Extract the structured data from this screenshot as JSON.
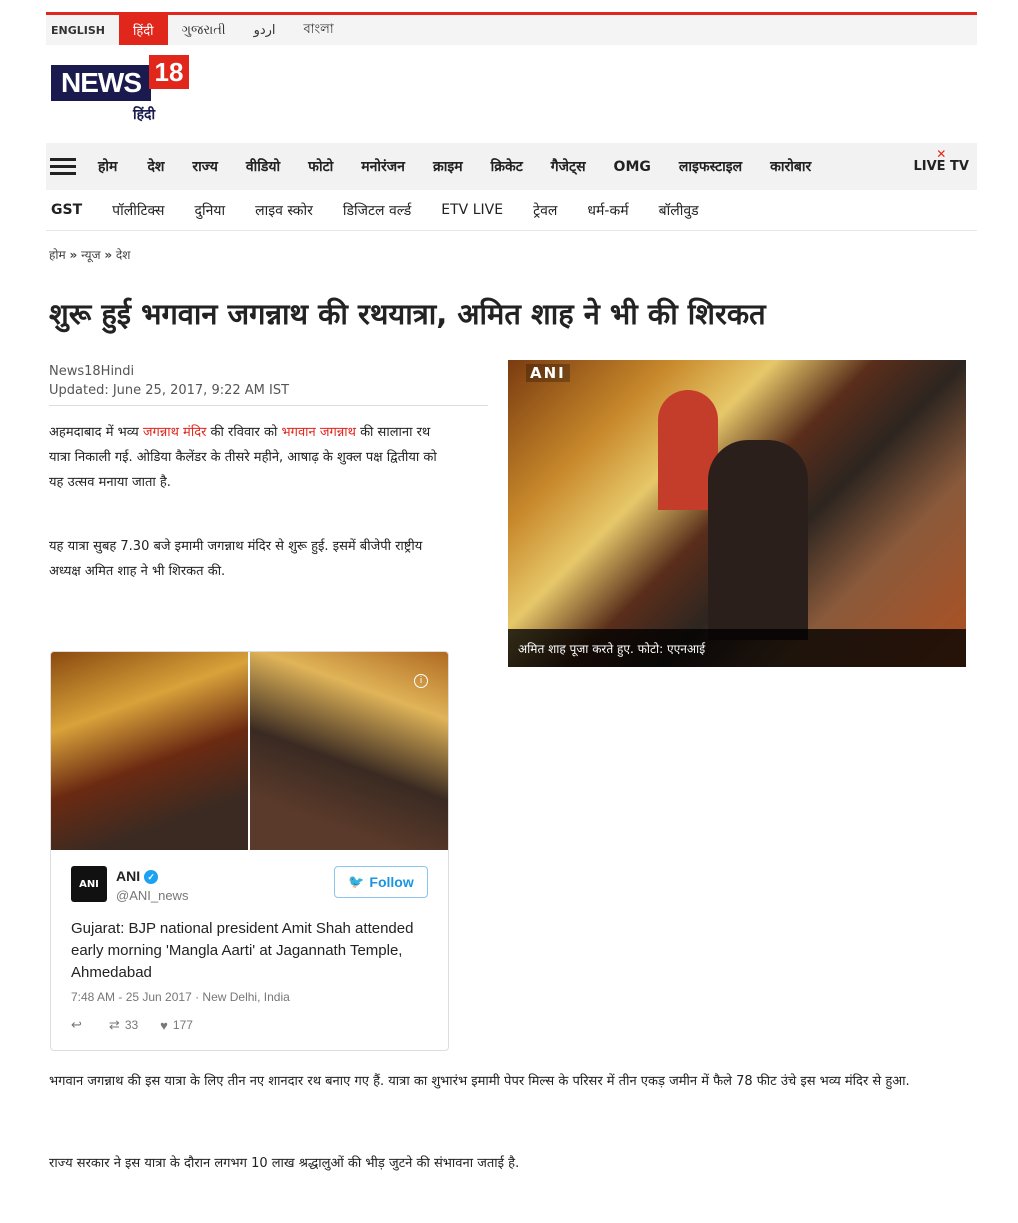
{
  "languages": [
    "ENGLISH",
    "हिंदी",
    "ગુજરાતી",
    "اردو",
    "বাংলা"
  ],
  "active_language_index": 1,
  "logo": {
    "word": "NEWS",
    "number": "18",
    "sub": "हिंदी"
  },
  "nav": [
    "होम",
    "देश",
    "राज्य",
    "वीडियो",
    "फोटो",
    "मनोरंजन",
    "क्राइम",
    "क्रिकेट",
    "गैजेट्स",
    "OMG",
    "लाइफस्टाइल",
    "कारोबार"
  ],
  "live_tv": "LIVE TV",
  "subnav": [
    "GST",
    "पॉलीटिक्स",
    "दुनिया",
    "लाइव स्कोर",
    "डिजिटल वर्ल्ड",
    "ETV LIVE",
    "ट्रेवल",
    "धर्म-कर्म",
    "बॉलीवुड"
  ],
  "breadcrumb": {
    "home": "होम",
    "sep": "»",
    "news": "न्यूज",
    "desh": "देश"
  },
  "headline": "शुरू हुई भगवान जगन्नाथ की रथयात्रा, अमित शाह ने भी की शिरकत",
  "byline": {
    "author": "News18Hindi",
    "updated": "Updated: June 25, 2017, 9:22 AM IST"
  },
  "para1": {
    "t1": "अहमदाबाद में भव्य ",
    "link1": "जगन्नाथ मंदिर",
    "t2": " की रविवार को ",
    "link2": "भगवान जगन्नाथ",
    "t3": " की सालाना रथ यात्रा निकाली गई. ओडिया कैलेंडर के तीसरे महीने, आषाढ़ के शुक्ल पक्ष द्वितीया को यह उत्सव मनाया जाता है."
  },
  "para2": "यह यात्रा सुबह 7.30 बजे इमामी जगन्नाथ मंदिर से शुरू हुई. इसमें बीजेपी राष्ट्रीय अध्यक्ष अमित शाह ने भी शिरकत की.",
  "photo": {
    "watermark": "ANI",
    "caption": "अमित शाह पूजा करते हुए. फोटो: एएनआई"
  },
  "tweet": {
    "avatar_text": "ANI",
    "name": "ANI",
    "handle": "@ANI_news",
    "follow": "Follow",
    "text": "Gujarat: BJP national president Amit Shah attended early morning 'Mangla Aarti' at Jagannath Temple, Ahmedabad",
    "meta": "7:48 AM - 25 Jun 2017 · New Delhi, India",
    "retweets": "33",
    "likes": "177"
  },
  "para3": "भगवान जगन्नाथ की इस यात्रा के लिए तीन नए शानदार रथ बनाए गए हैं. यात्रा का शुभारंभ इमामी पेपर मिल्स के परिसर में तीन एकड़ जमीन में फैले 78 फीट उंचे इस भव्य मंदिर से हुआ.",
  "para4": "राज्य सरकार ने इस यात्रा के दौरान लगभग 10 लाख श्रद्धालुओं की भीड़ जुटने की संभावना जताई है."
}
